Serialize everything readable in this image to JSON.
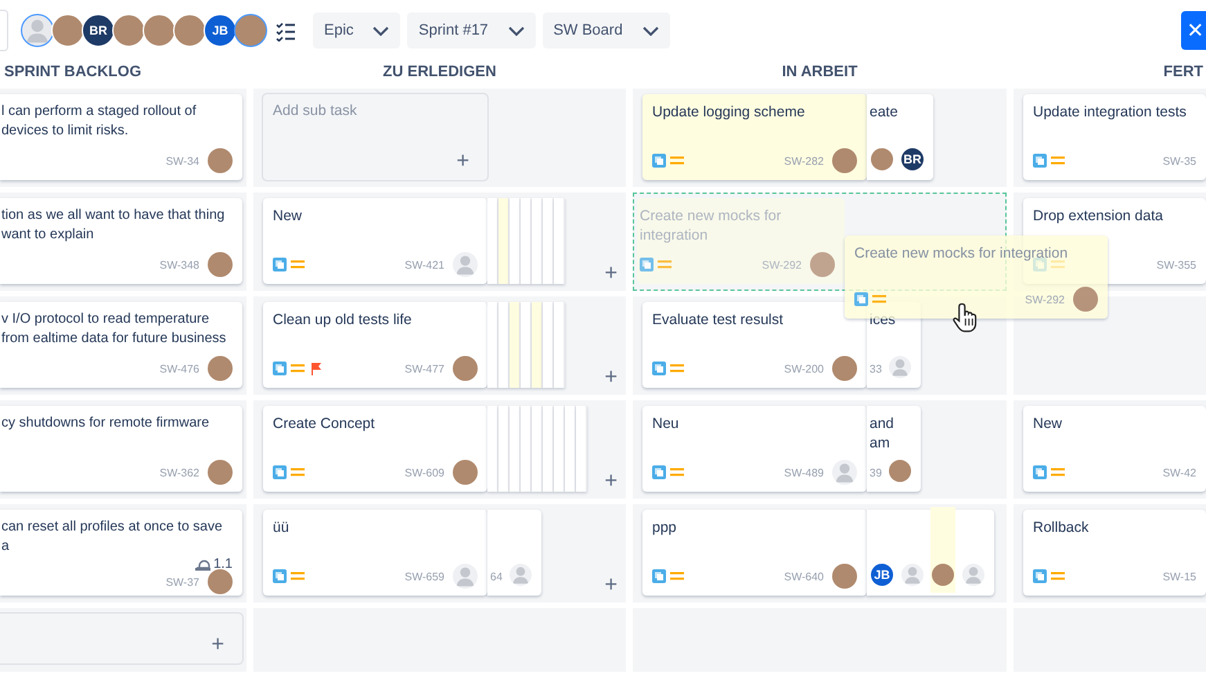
{
  "toolbar": {
    "avatars": [
      {
        "kind": "empty",
        "selected": true
      },
      {
        "kind": "photo",
        "selected": false
      },
      {
        "kind": "initials",
        "text": "BR",
        "selected": false
      },
      {
        "kind": "photo",
        "selected": false
      },
      {
        "kind": "photo",
        "selected": false
      },
      {
        "kind": "photo",
        "selected": false
      },
      {
        "kind": "initials",
        "text": "JB",
        "selected": false
      },
      {
        "kind": "photo",
        "selected": true
      }
    ],
    "filters": [
      {
        "label": "Epic"
      },
      {
        "label": "Sprint #17"
      },
      {
        "label": "SW Board"
      }
    ],
    "close_button": "✕"
  },
  "columns": [
    {
      "title": "SPRINT BACKLOG"
    },
    {
      "title": "ZU ERLEDIGEN"
    },
    {
      "title": "IN ARBEIT"
    },
    {
      "title": "FERT"
    }
  ],
  "rows": [
    {
      "cells": [
        {
          "card": {
            "kind": "task",
            "title": "l can perform a staged rollout of devices to limit risks.",
            "key": "SW-34",
            "avatar": {
              "kind": "photo"
            }
          }
        },
        {
          "card": {
            "kind": "placeholder",
            "title": "Add sub task",
            "add": "+"
          }
        },
        {
          "card": {
            "kind": "task",
            "title": "Update logging scheme",
            "highlighted": true,
            "icons": [
              {
                "kind": "story"
              },
              {
                "kind": "priority"
              }
            ],
            "key": "SW-282",
            "avatar": {
              "kind": "photo"
            }
          },
          "peek": {
            "lines": [
              "eate"
            ],
            "avatars": [
              {
                "kind": "photo"
              },
              {
                "kind": "initials",
                "text": "BR"
              }
            ]
          }
        },
        {
          "card": {
            "kind": "task",
            "title": "Update integration tests",
            "icons": [
              {
                "kind": "story"
              },
              {
                "kind": "priority"
              }
            ],
            "key": "SW-35"
          }
        }
      ]
    },
    {
      "cells": [
        {
          "card": {
            "kind": "task",
            "title": "tion as we all want to have that thing want to explain",
            "key": "SW-348",
            "avatar": {
              "kind": "photo"
            }
          }
        },
        {
          "card": {
            "kind": "task",
            "title": "New",
            "icons": [
              {
                "kind": "story"
              },
              {
                "kind": "priority"
              }
            ],
            "key": "SW-421",
            "avatar": {
              "kind": "empty"
            }
          },
          "stack": [
            {
              "highlighted": false
            },
            {
              "highlighted": true
            },
            {
              "highlighted": false
            },
            {
              "highlighted": false
            },
            {
              "highlighted": false
            },
            {
              "highlighted": false
            },
            {
              "highlighted": false
            }
          ],
          "add": "+"
        },
        {
          "drop_zone": true,
          "card": {
            "kind": "ghost",
            "title": "Create new mocks for integration",
            "icons": [
              {
                "kind": "story"
              },
              {
                "kind": "priority"
              }
            ],
            "key": "SW-292",
            "avatar": {
              "kind": "photo"
            }
          }
        },
        {
          "card": {
            "kind": "task",
            "title": "Drop extension data",
            "icons": [
              {
                "kind": "story"
              },
              {
                "kind": "priority"
              }
            ],
            "key": "SW-355"
          }
        }
      ]
    },
    {
      "cells": [
        {
          "card": {
            "kind": "task",
            "title": "v I/O protocol to read temperature from ealtime data for future business",
            "key": "SW-476",
            "avatar": {
              "kind": "photo"
            }
          }
        },
        {
          "card": {
            "kind": "task",
            "title": "Clean up old tests life",
            "icons": [
              {
                "kind": "story"
              },
              {
                "kind": "priority"
              },
              {
                "kind": "flag"
              }
            ],
            "key": "SW-477",
            "avatar": {
              "kind": "photo"
            }
          },
          "stack": [
            {
              "highlighted": false
            },
            {
              "highlighted": false
            },
            {
              "highlighted": true
            },
            {
              "highlighted": false
            },
            {
              "highlighted": true
            },
            {
              "highlighted": false
            },
            {
              "highlighted": false
            }
          ],
          "add": "+"
        },
        {
          "card": {
            "kind": "task",
            "title": "Evaluate test resulst",
            "icons": [
              {
                "kind": "story"
              },
              {
                "kind": "priority"
              }
            ],
            "key": "SW-200",
            "avatar": {
              "kind": "photo"
            }
          },
          "peek": {
            "lines": [
              "ices"
            ],
            "key": "33",
            "avatars": [
              {
                "kind": "empty"
              }
            ]
          }
        },
        {}
      ]
    },
    {
      "cells": [
        {
          "card": {
            "kind": "task",
            "title": "cy shutdowns for remote firmware",
            "key": "SW-362",
            "avatar": {
              "kind": "photo"
            }
          }
        },
        {
          "card": {
            "kind": "task",
            "title": "Create Concept",
            "icons": [
              {
                "kind": "story"
              },
              {
                "kind": "priority"
              }
            ],
            "key": "SW-609",
            "avatar": {
              "kind": "photo"
            }
          },
          "stack": [
            {
              "highlighted": false
            },
            {
              "highlighted": false
            },
            {
              "highlighted": false
            },
            {
              "highlighted": false
            },
            {
              "highlighted": false
            },
            {
              "highlighted": false
            },
            {
              "highlighted": false
            },
            {
              "highlighted": false
            },
            {
              "highlighted": false
            }
          ],
          "add": "+"
        },
        {
          "card": {
            "kind": "task",
            "title": "Neu",
            "icons": [
              {
                "kind": "story"
              },
              {
                "kind": "priority"
              }
            ],
            "key": "SW-489",
            "avatar": {
              "kind": "empty"
            }
          },
          "peek": {
            "lines": [
              "and",
              "am"
            ],
            "key": "39",
            "avatars": [
              {
                "kind": "photo"
              }
            ]
          }
        },
        {
          "card": {
            "kind": "task",
            "title": "New",
            "icons": [
              {
                "kind": "story"
              },
              {
                "kind": "priority"
              }
            ],
            "key": "SW-42"
          }
        }
      ]
    },
    {
      "cells": [
        {
          "card": {
            "kind": "task",
            "title": "can reset all profiles at once to save a",
            "estimate": "1.1",
            "key": "SW-37",
            "avatar": {
              "kind": "photo"
            }
          }
        },
        {
          "card": {
            "kind": "task",
            "title": "üü",
            "icons": [
              {
                "kind": "story"
              },
              {
                "kind": "priority"
              }
            ],
            "key": "SW-659",
            "avatar": {
              "kind": "empty"
            }
          },
          "peek": {
            "key": "64",
            "avatars": [
              {
                "kind": "empty"
              }
            ]
          },
          "add": "+"
        },
        {
          "card": {
            "kind": "task",
            "title": "ppp",
            "icons": [
              {
                "kind": "story"
              },
              {
                "kind": "priority"
              }
            ],
            "key": "SW-640",
            "avatar": {
              "kind": "photo"
            }
          },
          "peek": {
            "avatars": [
              {
                "kind": "initials",
                "text": "JB"
              },
              {
                "kind": "empty"
              },
              {
                "kind": "photo",
                "highlighted": true
              },
              {
                "kind": "empty"
              }
            ]
          }
        },
        {
          "card": {
            "kind": "task",
            "title": "Rollback",
            "icons": [
              {
                "kind": "story"
              },
              {
                "kind": "priority"
              }
            ],
            "key": "SW-15"
          }
        }
      ]
    },
    {
      "cells": [
        {
          "card": {
            "kind": "placeholder",
            "add": "+"
          }
        },
        {},
        {},
        {}
      ]
    }
  ],
  "drag_card": {
    "title": "Create new mocks for integration",
    "icons": [
      {
        "kind": "story"
      },
      {
        "kind": "priority"
      }
    ],
    "key": "SW-292",
    "avatar": {
      "kind": "photo"
    }
  }
}
